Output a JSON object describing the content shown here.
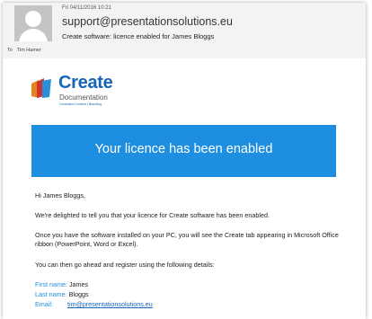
{
  "header": {
    "date": "Fri 04/11/2016 10:21",
    "from": "support@presentationsolutions.eu",
    "subject": "Create software: licence enabled for James Bloggs",
    "to_label": "To",
    "to_value": "Tim Hamer"
  },
  "logo": {
    "name": "Create",
    "subtitle": "Documentation",
    "tagline": "Consistent Content • Branding"
  },
  "banner": {
    "text": "Your licence has been enabled"
  },
  "body": {
    "greeting": "Hi James Bloggs,",
    "paragraph1": "We're delighted to tell you that your licence for Create software has been enabled.",
    "paragraph2": "Once you have the software installed on your PC, you will see the Create tab appearing in Microsoft Office ribbon (PowerPoint, Word or Excel).",
    "paragraph3": "You can then go ahead and register using the following details:",
    "fields": {
      "first_name_label": "First name:",
      "first_name_value": "James",
      "last_name_label": "Last name:",
      "last_name_value": "Bloggs",
      "email_label": "Email:",
      "email_value": "tim@presentationsolutions.eu"
    }
  },
  "colors": {
    "banner": "#1e8fe0",
    "brand": "#1565b8"
  }
}
